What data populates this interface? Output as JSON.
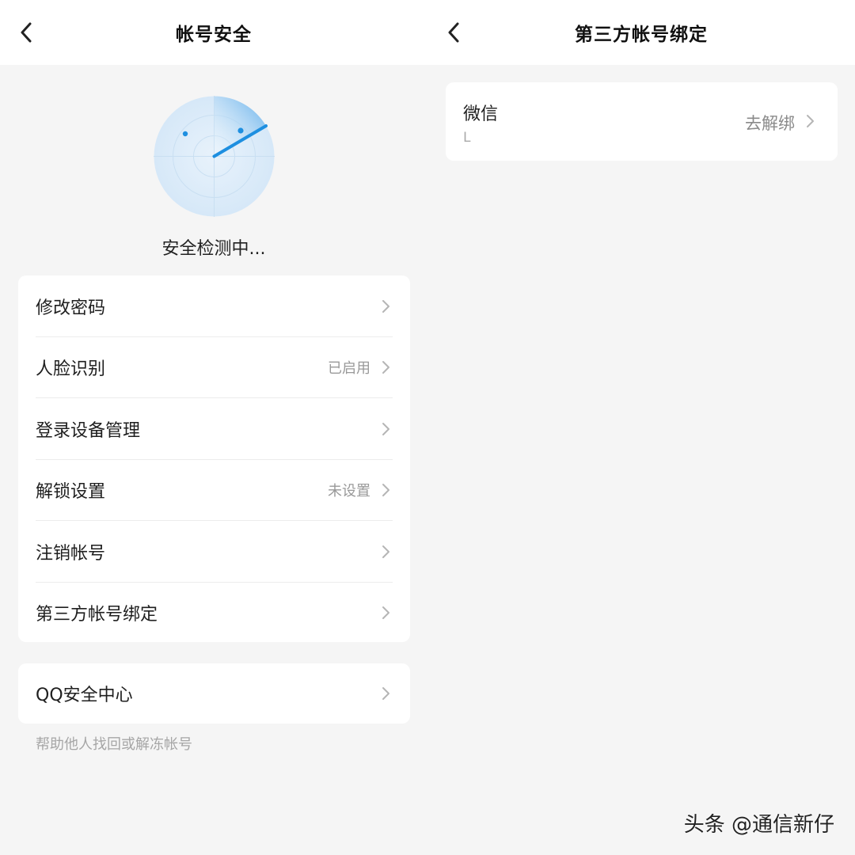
{
  "left_screen": {
    "nav": {
      "title": "帐号安全"
    },
    "scan_status": "安全检测中...",
    "items": [
      {
        "label": "修改密码",
        "value": ""
      },
      {
        "label": "人脸识别",
        "value": "已启用"
      },
      {
        "label": "登录设备管理",
        "value": ""
      },
      {
        "label": "解锁设置",
        "value": "未设置"
      },
      {
        "label": "注销帐号",
        "value": ""
      },
      {
        "label": "第三方帐号绑定",
        "value": ""
      }
    ],
    "qq_center": {
      "label": "QQ安全中心",
      "hint": "帮助他人找回或解冻帐号"
    }
  },
  "right_screen": {
    "nav": {
      "title": "第三方帐号绑定"
    },
    "binding": {
      "name": "微信",
      "sub": "L",
      "action": "去解绑"
    }
  },
  "watermark": "头条 @通信新仔",
  "colors": {
    "accent": "#1e8fe0",
    "radar_light": "#dcecf9",
    "chevron": "#b5b5b5"
  },
  "icons": {
    "back": "chevron-left-icon",
    "row_arrow": "chevron-right-icon",
    "radar": "radar-scan-icon"
  }
}
